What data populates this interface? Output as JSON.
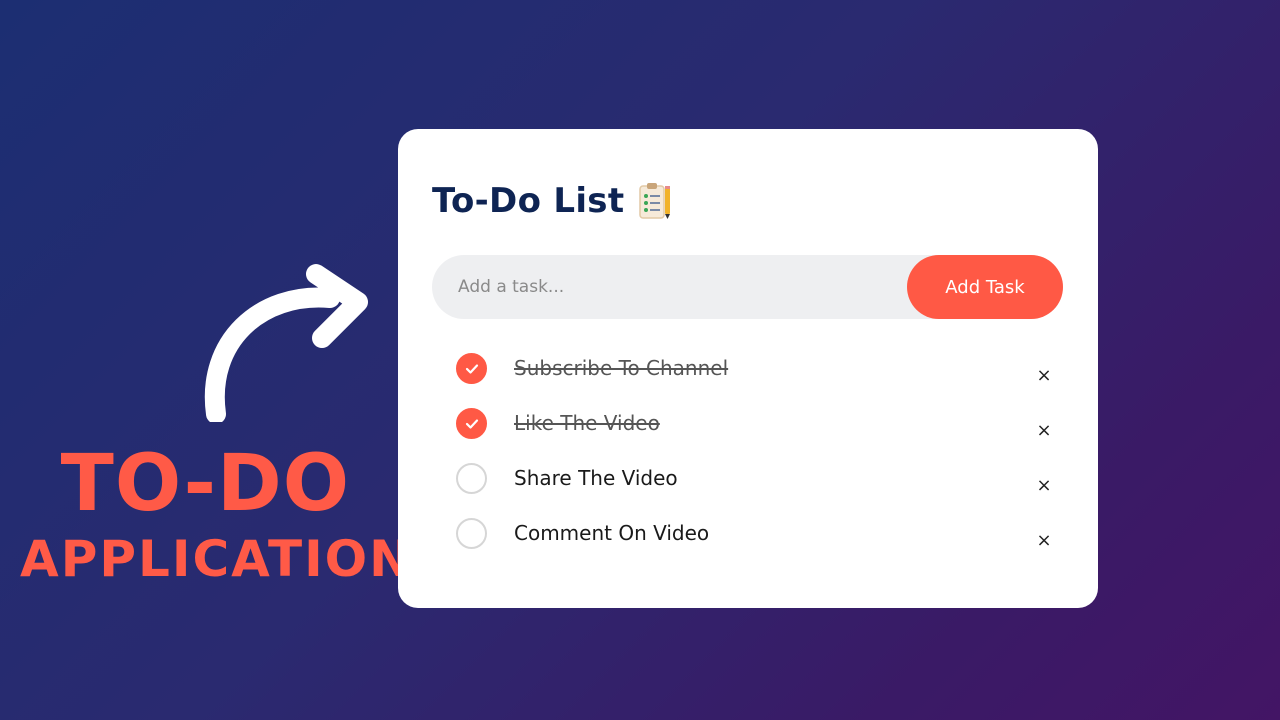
{
  "promo": {
    "line1": "TO-DO",
    "line2": "APPLICATION"
  },
  "app": {
    "title": "To-Do List",
    "title_icon": "clipboard-with-pencil-icon",
    "input": {
      "placeholder": "Add a task...",
      "value": ""
    },
    "add_button_label": "Add Task",
    "tasks": [
      {
        "text": "Subscribe To Channel",
        "done": true
      },
      {
        "text": "Like The Video",
        "done": true
      },
      {
        "text": "Share The Video",
        "done": false
      },
      {
        "text": "Comment On Video",
        "done": false
      }
    ],
    "delete_symbol": "×"
  },
  "colors": {
    "accent": "#ff5945",
    "title": "#0e2453",
    "background_start": "#1c2e72",
    "background_end": "#431565"
  }
}
